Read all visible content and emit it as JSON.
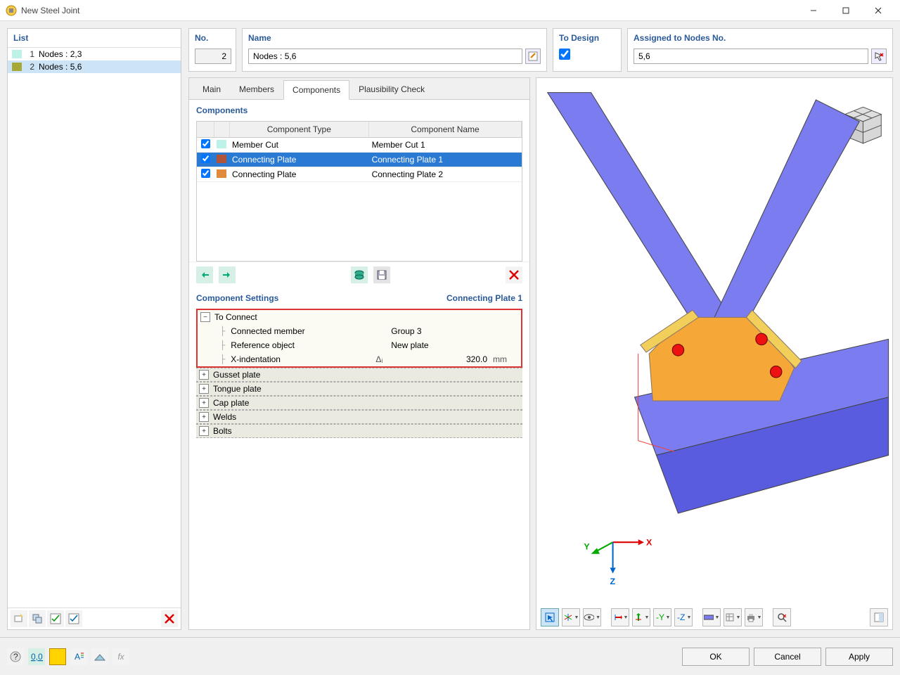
{
  "window": {
    "title": "New Steel Joint"
  },
  "list": {
    "header": "List",
    "items": [
      {
        "num": "1",
        "label": "Nodes : 2,3",
        "color": "#bdf2e8"
      },
      {
        "num": "2",
        "label": "Nodes : 5,6",
        "color": "#a7a835"
      }
    ],
    "selected": 1
  },
  "fields": {
    "no_label": "No.",
    "no_value": "2",
    "name_label": "Name",
    "name_value": "Nodes : 5,6",
    "design_label": "To Design",
    "nodes_label": "Assigned to Nodes No.",
    "nodes_value": "5,6"
  },
  "tabs": {
    "items": [
      "Main",
      "Members",
      "Components",
      "Plausibility Check"
    ],
    "active": 2
  },
  "components": {
    "header": "Components",
    "col_type": "Component Type",
    "col_name": "Component Name",
    "rows": [
      {
        "checked": true,
        "color": "#bdf2e8",
        "type": "Member Cut",
        "name": "Member Cut 1"
      },
      {
        "checked": true,
        "color": "#b0543a",
        "type": "Connecting Plate",
        "name": "Connecting Plate 1"
      },
      {
        "checked": true,
        "color": "#e08b3c",
        "type": "Connecting Plate",
        "name": "Connecting Plate 2"
      }
    ],
    "selected": 1
  },
  "settings": {
    "header": "Component Settings",
    "active_name": "Connecting Plate 1",
    "to_connect": {
      "label": "To Connect",
      "rows": [
        {
          "label": "Connected member",
          "sym": "",
          "value": "Group 3",
          "unit": ""
        },
        {
          "label": "Reference object",
          "sym": "",
          "value": "New plate",
          "unit": ""
        },
        {
          "label": "X-indentation",
          "sym": "Δᵢ",
          "value": "320.0",
          "unit": "mm",
          "numeric": true
        }
      ]
    },
    "groups": [
      "Gusset plate",
      "Tongue plate",
      "Cap plate",
      "Welds",
      "Bolts"
    ]
  },
  "viewport_toolbar": [],
  "dialog": {
    "ok": "OK",
    "cancel": "Cancel",
    "apply": "Apply"
  }
}
